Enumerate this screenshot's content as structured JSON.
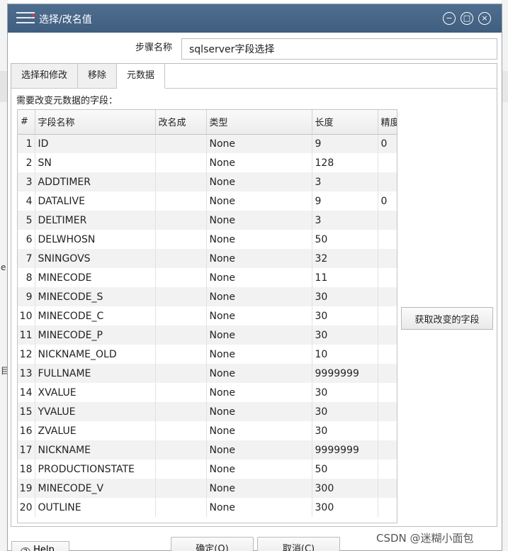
{
  "window": {
    "title": "选择/改名值",
    "minimize_glyph": "−",
    "maximize_glyph": "□",
    "close_glyph": "×"
  },
  "step": {
    "label": "步骤名称",
    "value": "sqlserver字段选择"
  },
  "tabs": [
    {
      "label": "选择和修改",
      "active": false
    },
    {
      "label": "移除",
      "active": false
    },
    {
      "label": "元数据",
      "active": true
    }
  ],
  "section_label": "需要改变元数据的字段：",
  "grid": {
    "columns": [
      "#",
      "字段名称",
      "改名成",
      "类型",
      "长度",
      "精度"
    ],
    "rows": [
      [
        "1",
        "ID",
        "",
        "None",
        "9",
        "0"
      ],
      [
        "2",
        "SN",
        "",
        "None",
        "128",
        ""
      ],
      [
        "3",
        "ADDTIMER",
        "",
        "None",
        "3",
        ""
      ],
      [
        "4",
        "DATALIVE",
        "",
        "None",
        "9",
        "0"
      ],
      [
        "5",
        "DELTIMER",
        "",
        "None",
        "3",
        ""
      ],
      [
        "6",
        "DELWHOSN",
        "",
        "None",
        "50",
        ""
      ],
      [
        "7",
        "SNINGOVS",
        "",
        "None",
        "32",
        ""
      ],
      [
        "8",
        "MINECODE",
        "",
        "None",
        "11",
        ""
      ],
      [
        "9",
        "MINECODE_S",
        "",
        "None",
        "30",
        ""
      ],
      [
        "10",
        "MINECODE_C",
        "",
        "None",
        "30",
        ""
      ],
      [
        "11",
        "MINECODE_P",
        "",
        "None",
        "30",
        ""
      ],
      [
        "12",
        "NICKNAME_OLD",
        "",
        "None",
        "10",
        ""
      ],
      [
        "13",
        "FULLNAME",
        "",
        "None",
        "9999999",
        ""
      ],
      [
        "14",
        "XVALUE",
        "",
        "None",
        "30",
        ""
      ],
      [
        "15",
        "YVALUE",
        "",
        "None",
        "30",
        ""
      ],
      [
        "16",
        "ZVALUE",
        "",
        "None",
        "30",
        ""
      ],
      [
        "17",
        "NICKNAME",
        "",
        "None",
        "9999999",
        ""
      ],
      [
        "18",
        "PRODUCTIONSTATE",
        "",
        "None",
        "50",
        ""
      ],
      [
        "19",
        "MINECODE_V",
        "",
        "None",
        "300",
        ""
      ],
      [
        "20",
        "OUTLINE",
        "",
        "None",
        "300",
        ""
      ]
    ]
  },
  "buttons": {
    "fetch": "获取改变的字段",
    "ok": "确定(O)",
    "cancel": "取消(C)",
    "help": "Help"
  },
  "watermark": "CSDN @迷糊小面包",
  "background_glyphs": [
    "e",
    "目"
  ]
}
